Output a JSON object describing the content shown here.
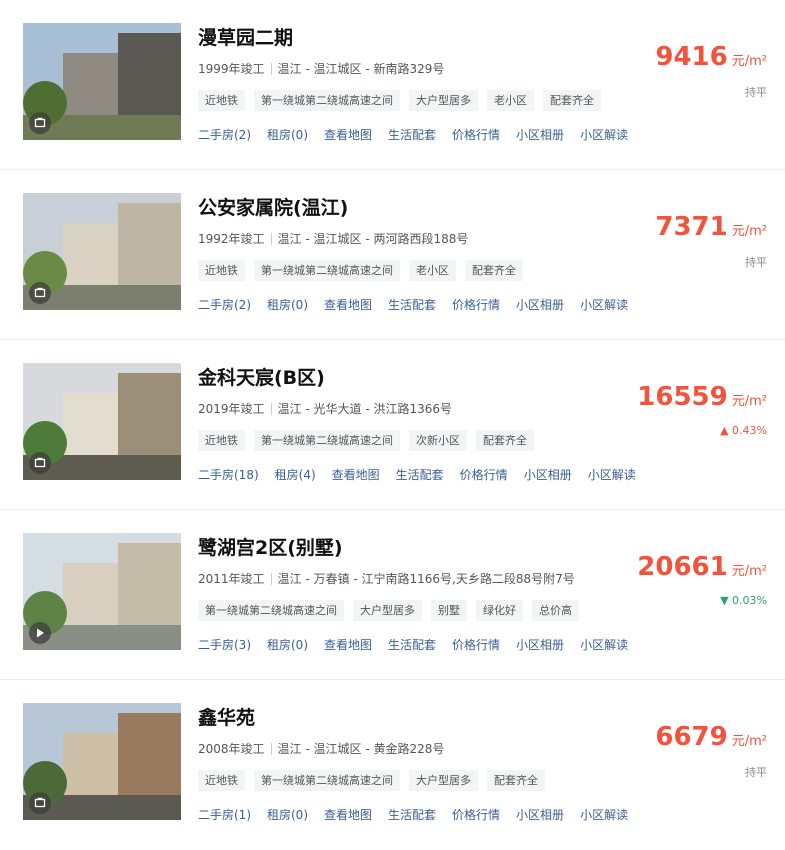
{
  "links": [
    "二手房",
    "租房",
    "查看地图",
    "生活配套",
    "价格行情",
    "小区相册",
    "小区解读"
  ],
  "listings": [
    {
      "name": "漫草园二期",
      "year": "1999年竣工",
      "location": "温江 - 温江城区 - 新南路329号",
      "tags": [
        "近地铁",
        "第一绕城第二绕城高速之间",
        "大户型居多",
        "老小区",
        "配套齐全"
      ],
      "second_hand": "二手房(2)",
      "rent": "租房(0)",
      "price": "9416",
      "unit": "元/m²",
      "trend": "持平",
      "trend_dir": "flat",
      "media": "photo-icon"
    },
    {
      "name": "公安家属院(温江)",
      "year": "1992年竣工",
      "location": "温江 - 温江城区 - 两河路西段188号",
      "tags": [
        "近地铁",
        "第一绕城第二绕城高速之间",
        "老小区",
        "配套齐全"
      ],
      "second_hand": "二手房(2)",
      "rent": "租房(0)",
      "price": "7371",
      "unit": "元/m²",
      "trend": "持平",
      "trend_dir": "flat",
      "media": "photo-icon"
    },
    {
      "name": "金科天宸(B区)",
      "year": "2019年竣工",
      "location": "温江 - 光华大道 - 洪江路1366号",
      "tags": [
        "近地铁",
        "第一绕城第二绕城高速之间",
        "次新小区",
        "配套齐全"
      ],
      "second_hand": "二手房(18)",
      "rent": "租房(4)",
      "price": "16559",
      "unit": "元/m²",
      "trend": "▲ 0.43%",
      "trend_dir": "up",
      "media": "photo-icon"
    },
    {
      "name": "鹭湖宫2区(别墅)",
      "year": "2011年竣工",
      "location": "温江 - 万春镇 - 江宁南路1166号,天乡路二段88号附7号",
      "tags": [
        "第一绕城第二绕城高速之间",
        "大户型居多",
        "别墅",
        "绿化好",
        "总价高"
      ],
      "second_hand": "二手房(3)",
      "rent": "租房(0)",
      "price": "20661",
      "unit": "元/m²",
      "trend": "▼ 0.03%",
      "trend_dir": "down",
      "media": "play-icon"
    },
    {
      "name": "鑫华苑",
      "year": "2008年竣工",
      "location": "温江 - 温江城区 - 黄金路228号",
      "tags": [
        "近地铁",
        "第一绕城第二绕城高速之间",
        "大户型居多",
        "配套齐全"
      ],
      "second_hand": "二手房(1)",
      "rent": "租房(0)",
      "price": "6679",
      "unit": "元/m²",
      "trend": "持平",
      "trend_dir": "flat",
      "media": "photo-icon"
    }
  ]
}
